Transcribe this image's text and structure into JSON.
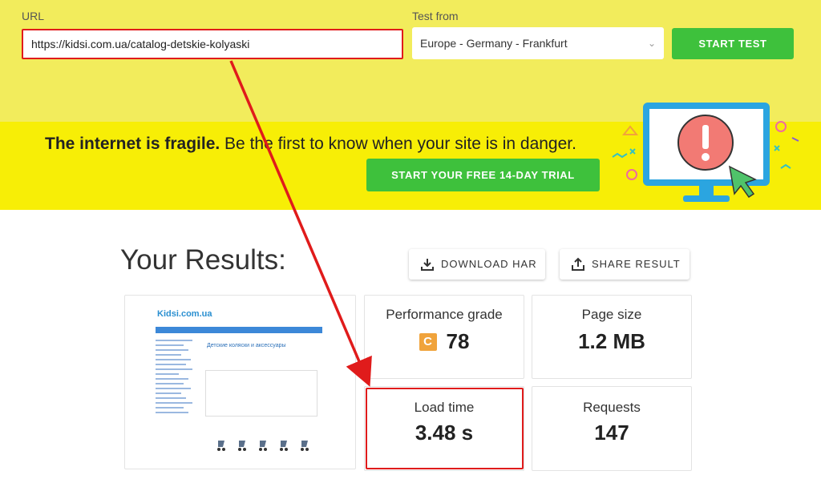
{
  "form": {
    "url_label": "URL",
    "url_value": "https://kidsi.com.ua/catalog-detskie-kolyaski",
    "test_from_label": "Test from",
    "location_value": "Europe - Germany - Frankfurt",
    "start_button": "START TEST"
  },
  "promo": {
    "bold_text": "The internet is fragile.",
    "rest_text": " Be the first to know when your site is in danger.",
    "trial_button": "START YOUR FREE 14-DAY TRIAL"
  },
  "results": {
    "title": "Your Results:",
    "download_button": "DOWNLOAD HAR",
    "share_button": "SHARE RESULT",
    "metrics": {
      "performance_label": "Performance grade",
      "performance_grade": "C",
      "performance_value": "78",
      "page_size_label": "Page size",
      "page_size_value": "1.2 MB",
      "load_time_label": "Load time",
      "load_time_value": "3.48 s",
      "requests_label": "Requests",
      "requests_value": "147"
    },
    "thumbnail": {
      "logo": "Kidsi.com.ua",
      "heading": "Детские коляски и аксессуары"
    }
  },
  "colors": {
    "form_bg": "#f2ec5c",
    "promo_bg": "#f7ee06",
    "accent_green": "#3ec13c",
    "annotation_red": "#e01b1b",
    "grade_orange": "#f0a33b"
  }
}
